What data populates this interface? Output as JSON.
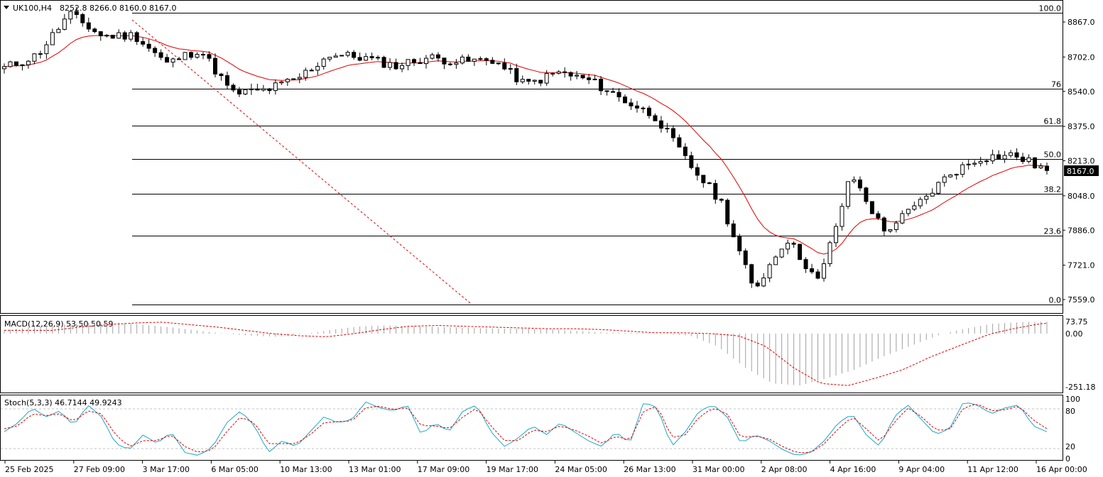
{
  "header": {
    "symbol": "UK100,H4",
    "ohlc": "8252.8 8266.0 8160.0 8167.0"
  },
  "price_axis": {
    "labels": [
      "8867.0",
      "8702.0",
      "8540.0",
      "8375.0",
      "8213.0",
      "8048.0",
      "7886.0",
      "7721.0",
      "7559.0"
    ],
    "current_price": "8167.0"
  },
  "fibonacci": {
    "levels": [
      {
        "label": "100.0",
        "price": 8910
      },
      {
        "label": "76",
        "price": 8552
      },
      {
        "label": "61.8",
        "price": 8380
      },
      {
        "label": "50.0",
        "price": 8223
      },
      {
        "label": "38.2",
        "price": 8058
      },
      {
        "label": "23.6",
        "price": 7859
      },
      {
        "label": "0.0",
        "price": 7534
      }
    ]
  },
  "macd": {
    "label": "MACD(12,26,9) 53.50 50.59",
    "axis_labels": [
      "73.75",
      "0.00",
      "-251.18"
    ]
  },
  "stoch": {
    "label": "Stoch(5,3,3) 46.7144 49.9243",
    "axis_labels": [
      "100",
      "80",
      "20",
      "0"
    ]
  },
  "time_axis": {
    "labels": [
      "25 Feb 2025",
      "27 Feb 09:00",
      "3 Mar 17:00",
      "6 Mar 05:00",
      "10 Mar 13:00",
      "13 Mar 01:00",
      "17 Mar 09:00",
      "19 Mar 17:00",
      "24 Mar 05:00",
      "26 Mar 13:00",
      "31 Mar 00:00",
      "2 Apr 08:00",
      "4 Apr 16:00",
      "9 Apr 04:00",
      "11 Apr 12:00",
      "16 Apr 00:00"
    ]
  },
  "colors": {
    "ma": "#e00000",
    "signal": "#e00000",
    "stoch_main": "#1aa8c8",
    "histogram": "#a0a0a0",
    "candle": "#000000"
  },
  "chart_data": [
    {
      "type": "candlestick",
      "title": "UK100,H4",
      "ylim": [
        7534,
        8910
      ],
      "close_path": [
        {
          "x": "25 Feb 2025",
          "close": 8650
        },
        {
          "x": "27 Feb 09:00",
          "close": 8710
        },
        {
          "x": "28 Feb",
          "close": 8905
        },
        {
          "x": "3 Mar 17:00",
          "close": 8800
        },
        {
          "x": "4 Mar",
          "close": 8805
        },
        {
          "x": "6 Mar 05:00",
          "close": 8670
        },
        {
          "x": "7 Mar",
          "close": 8740
        },
        {
          "x": "10 Mar 13:00",
          "close": 8530
        },
        {
          "x": "13 Mar 01:00",
          "close": 8545
        },
        {
          "x": "14 Mar",
          "close": 8600
        },
        {
          "x": "17 Mar 09:00",
          "close": 8715
        },
        {
          "x": "19 Mar 17:00",
          "close": 8700
        },
        {
          "x": "24 Mar 05:00",
          "close": 8660
        },
        {
          "x": "25 Mar",
          "close": 8700
        },
        {
          "x": "26 Mar 13:00",
          "close": 8680
        },
        {
          "x": "28 Mar",
          "close": 8690
        },
        {
          "x": "31 Mar 00:00",
          "close": 8570
        },
        {
          "x": "1 Apr",
          "close": 8630
        },
        {
          "x": "2 Apr 08:00",
          "close": 8590
        },
        {
          "x": "3 Apr",
          "close": 8500
        },
        {
          "x": "3 Apr 16:00",
          "close": 8420
        },
        {
          "x": "4 Apr 04:00",
          "close": 8200
        },
        {
          "x": "4 Apr 16:00",
          "close": 8020
        },
        {
          "x": "7 Apr",
          "close": 7600
        },
        {
          "x": "8 Apr",
          "close": 7850
        },
        {
          "x": "9 Apr 04:00",
          "close": 7640
        },
        {
          "x": "9 Apr 20:00",
          "close": 8150
        },
        {
          "x": "10 Apr",
          "close": 7880
        },
        {
          "x": "11 Apr 12:00",
          "close": 8000
        },
        {
          "x": "14 Apr",
          "close": 8150
        },
        {
          "x": "15 Apr",
          "close": 8230
        },
        {
          "x": "16 Apr 00:00",
          "close": 8240
        },
        {
          "x": "16 Apr last",
          "close": 8167
        }
      ],
      "ma_label": "MA"
    },
    {
      "type": "bar",
      "title": "MACD(12,26,9) 53.50 50.59",
      "ylim": [
        -260,
        85
      ],
      "series": [
        {
          "name": "MACD",
          "values": [
            20,
            40,
            55,
            65,
            70,
            55,
            40,
            20,
            0,
            -10,
            -15,
            0,
            25,
            45,
            50,
            45,
            40,
            35,
            30,
            30,
            25,
            15,
            5,
            5,
            0,
            -10,
            -60,
            -160,
            -235,
            -245,
            -210,
            -170,
            -110,
            -60,
            -10,
            30,
            60,
            70,
            73
          ]
        }
      ]
    },
    {
      "type": "line",
      "title": "Stoch(5,3,3) 46.7144 49.9243",
      "ylim": [
        0,
        100
      ],
      "series": [
        {
          "name": "Stoch",
          "values": [
            45,
            60,
            85,
            70,
            80,
            55,
            90,
            70,
            25,
            15,
            40,
            25,
            45,
            10,
            5,
            20,
            60,
            80,
            55,
            10,
            30,
            20,
            45,
            70,
            60,
            65,
            95,
            85,
            80,
            90,
            40,
            60,
            45,
            80,
            90,
            45,
            20,
            35,
            55,
            40,
            60,
            45,
            30,
            20,
            45,
            25,
            95,
            85,
            20,
            45,
            80,
            90,
            70,
            25,
            40,
            30,
            15,
            5,
            10,
            30,
            60,
            75,
            40,
            20,
            70,
            90,
            65,
            40,
            50,
            95,
            90,
            75,
            85,
            90,
            55,
            45
          ]
        },
        {
          "name": "Signal",
          "values": [
            50,
            55,
            75,
            72,
            75,
            62,
            80,
            75,
            40,
            20,
            30,
            30,
            40,
            20,
            10,
            15,
            45,
            70,
            60,
            25,
            25,
            25,
            40,
            60,
            62,
            63,
            85,
            88,
            82,
            86,
            55,
            55,
            50,
            70,
            85,
            55,
            30,
            30,
            48,
            45,
            55,
            48,
            38,
            25,
            38,
            30,
            80,
            88,
            35,
            40,
            70,
            85,
            75,
            35,
            38,
            33,
            20,
            10,
            10,
            25,
            50,
            70,
            50,
            28,
            60,
            85,
            70,
            48,
            48,
            85,
            92,
            80,
            82,
            88,
            65,
            50
          ]
        }
      ]
    }
  ]
}
